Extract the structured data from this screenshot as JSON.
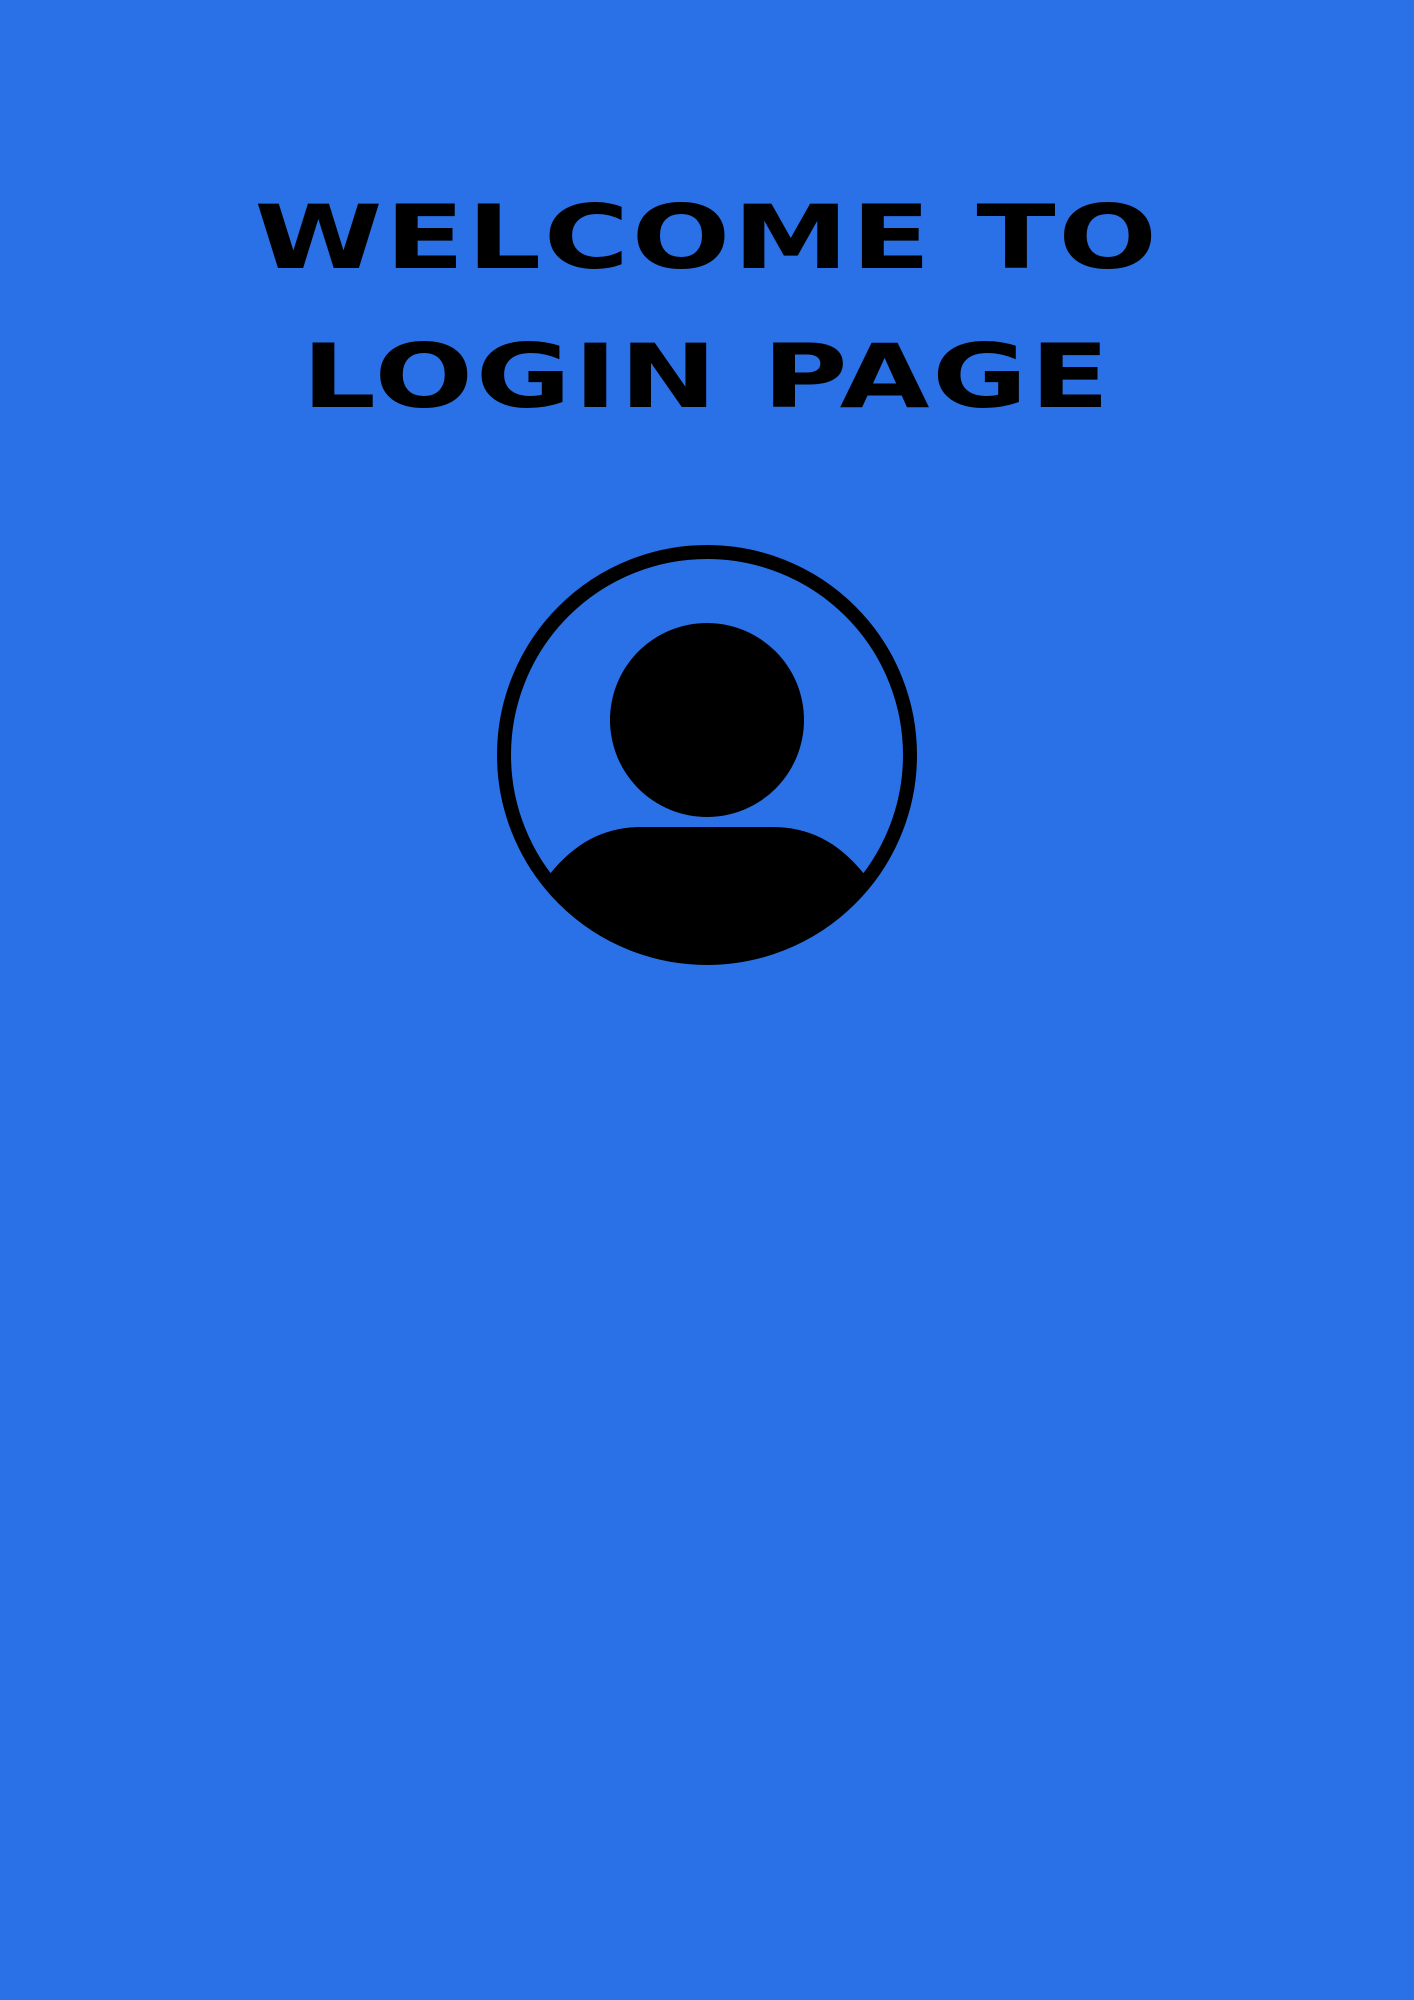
{
  "theme": {
    "background": "#2A70E6",
    "foreground": "#000000"
  },
  "header": {
    "title_line_1": "WELCOME TO",
    "title_line_2": "LOGIN PAGE"
  },
  "avatar": {
    "icon": "user-circle-icon"
  }
}
